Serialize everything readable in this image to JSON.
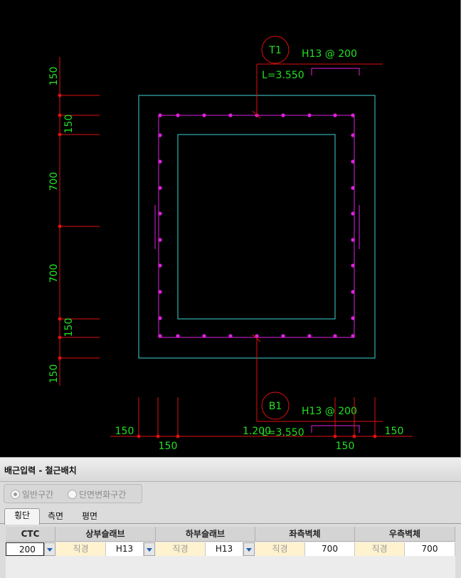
{
  "drawing": {
    "colors": {
      "background": "#000000",
      "concrete": "#3fd4d4",
      "rebar": "#e020e0",
      "dimension": "#e01010",
      "text": "#22e022"
    },
    "top_callout": {
      "mark": "T1",
      "spec": "H13 @ 200",
      "length": "L=3.550"
    },
    "bottom_callout": {
      "mark": "B1",
      "spec": "H13 @ 200",
      "length": "L=3.550"
    },
    "left_dimensions": [
      "150",
      "150",
      "700",
      "700",
      "150",
      "150"
    ],
    "bottom_dimensions": {
      "left_a": "150",
      "left_b": "150",
      "total": "1.200",
      "right_a": "150",
      "right_b": "150"
    }
  },
  "panel": {
    "title": "배근입력 - 철근배치",
    "mode_options": [
      {
        "label": "일반구간",
        "selected": true
      },
      {
        "label": "단면변화구간",
        "selected": false
      }
    ],
    "tabs": [
      "횡단",
      "측면",
      "평면"
    ],
    "active_tab": "횡단",
    "table": {
      "headers": [
        "CTC",
        "상부슬래브",
        "하부슬래브",
        "좌측벽체",
        "우측벽체"
      ],
      "ctc_value": "200",
      "top_slab": {
        "dia_label": "직경",
        "dia_value": "H13"
      },
      "bottom_slab": {
        "dia_label": "직경",
        "dia_value": "H13"
      },
      "left_wall": {
        "label": "직경",
        "value": "700"
      },
      "right_wall": {
        "label": "직경",
        "value": "700"
      }
    }
  }
}
